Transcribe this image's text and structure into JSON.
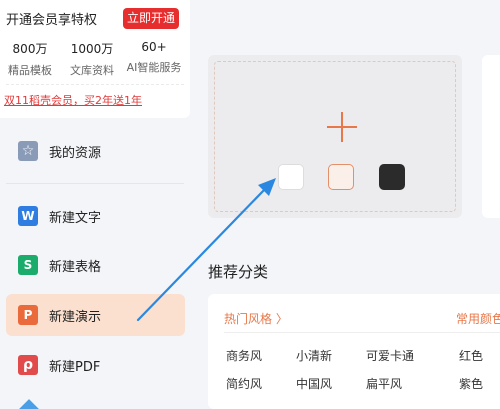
{
  "membership": {
    "title": "开通会员享特权",
    "cta": "立即开通",
    "stats": [
      {
        "value": "800万",
        "label": "精品模板"
      },
      {
        "value": "1000万",
        "label": "文库资料"
      },
      {
        "value": "60+",
        "label": "AI智能服务"
      }
    ],
    "promo": "双11稻壳会员，买2年送1年"
  },
  "sidebar": {
    "items": [
      {
        "label": "我的资源",
        "icon": "star-icon",
        "glyph": "☆",
        "color": "#8a9bb8",
        "active": false
      },
      {
        "label": "新建文字",
        "icon": "writer-icon",
        "glyph": "W",
        "color": "#2f7de1",
        "active": false
      },
      {
        "label": "新建表格",
        "icon": "spreadsheet-icon",
        "glyph": "S",
        "color": "#1bab6b",
        "active": false
      },
      {
        "label": "新建演示",
        "icon": "presentation-icon",
        "glyph": "P",
        "color": "#ea6a3c",
        "active": true
      },
      {
        "label": "新建PDF",
        "icon": "pdf-icon",
        "glyph": "ρ",
        "color": "#e24b4b",
        "active": false
      }
    ]
  },
  "templates": {
    "swatches": [
      {
        "name": "white-theme",
        "color": "#ffffff"
      },
      {
        "name": "peach-theme",
        "color": "#fbefe9"
      },
      {
        "name": "dark-theme",
        "color": "#2b2b2b"
      }
    ]
  },
  "recommend": {
    "title": "推荐分类",
    "tabs": [
      "热门风格 〉",
      "常用颜色"
    ],
    "styles": [
      [
        "商务风",
        "小清新",
        "可爱卡通",
        "红色"
      ],
      [
        "简约风",
        "中国风",
        "扁平风",
        "紫色"
      ]
    ]
  },
  "colors": {
    "accent": "#e8784a",
    "active_bg": "#fbe0cf",
    "cta_red": "#e62e2e",
    "pointer_blue": "#2a88e0"
  }
}
